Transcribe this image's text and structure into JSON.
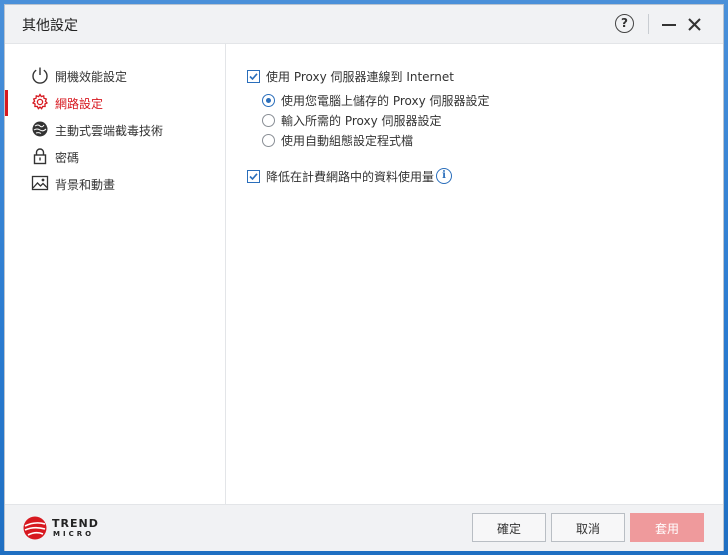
{
  "window": {
    "title": "其他設定",
    "help_label": "?"
  },
  "sidebar": {
    "items": [
      {
        "label": "開機效能設定",
        "icon": "power-icon",
        "active": false
      },
      {
        "label": "網路設定",
        "icon": "gear-icon",
        "active": true
      },
      {
        "label": "主動式雲端截毒技術",
        "icon": "globe-icon",
        "active": false
      },
      {
        "label": "密碼",
        "icon": "lock-icon",
        "active": false
      },
      {
        "label": "背景和動畫",
        "icon": "picture-icon",
        "active": false
      }
    ]
  },
  "network": {
    "use_proxy_label": "使用 Proxy 伺服器連線到 Internet",
    "use_proxy_checked": true,
    "proxy_options": [
      {
        "label": "使用您電腦上儲存的 Proxy 伺服器設定",
        "selected": true
      },
      {
        "label": "輸入所需的 Proxy 伺服器設定",
        "selected": false
      },
      {
        "label": "使用自動組態設定程式檔",
        "selected": false
      }
    ],
    "reduce_usage_label": "降低在計費網路中的資料使用量",
    "reduce_usage_checked": true,
    "info_label": "i"
  },
  "footer": {
    "brand_line1": "TREND",
    "brand_line2": "MICRO",
    "ok_label": "確定",
    "cancel_label": "取消",
    "apply_label": "套用"
  },
  "colors": {
    "accent_red": "#d71920",
    "accent_blue": "#2a6ebb",
    "apply_disabled": "#ef9a9c"
  }
}
